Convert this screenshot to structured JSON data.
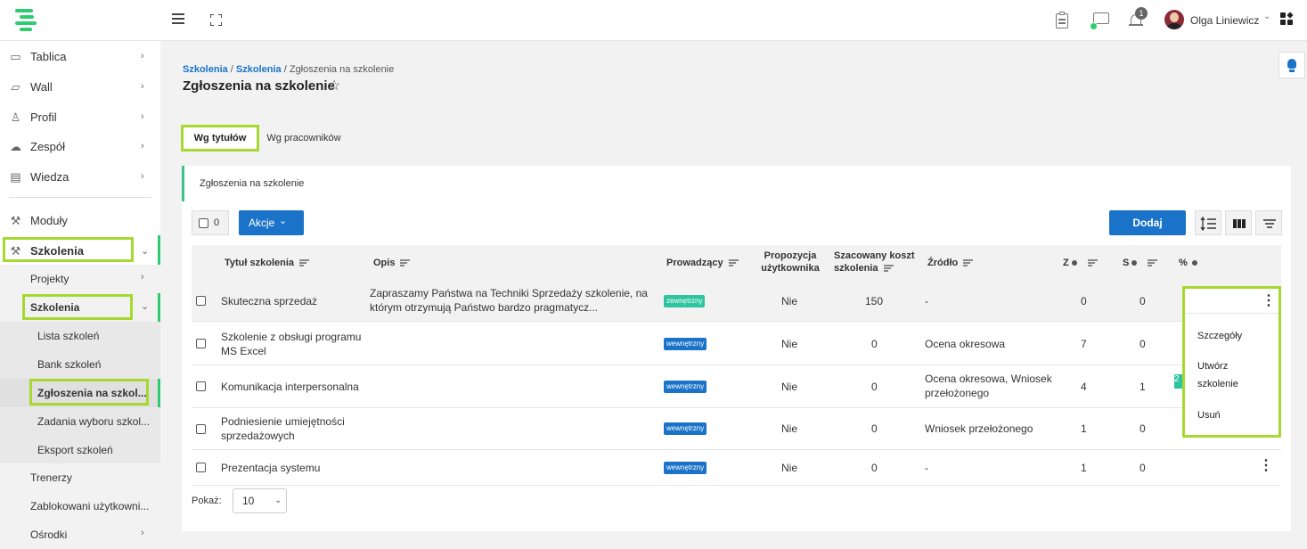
{
  "header": {
    "username": "Olga Liniewicz",
    "notifications_count": "1"
  },
  "sidebar": {
    "items": [
      {
        "label": "Tablica"
      },
      {
        "label": "Wall"
      },
      {
        "label": "Profil"
      },
      {
        "label": "Zespół"
      },
      {
        "label": "Wiedza"
      },
      {
        "label": "Moduły"
      },
      {
        "label": "Szkolenia"
      }
    ],
    "sub": [
      {
        "label": "Projekty"
      },
      {
        "label": "Szkolenia"
      }
    ],
    "sub2": [
      {
        "label": "Lista szkoleń"
      },
      {
        "label": "Bank szkoleń"
      },
      {
        "label": "Zgłoszenia na szkol..."
      },
      {
        "label": "Zadania wyboru szkol..."
      },
      {
        "label": "Eksport szkoleń"
      }
    ],
    "bottom": [
      {
        "label": "Trenerzy"
      },
      {
        "label": "Zablokowani użytkowni..."
      },
      {
        "label": "Ośrodki"
      }
    ]
  },
  "breadcrumb": {
    "part1": "Szkolenia",
    "sep": " / ",
    "part2": "Szkolenia",
    "part3": "Zgłoszenia na szkolenie"
  },
  "page_title": "Zgłoszenia na szkolenie",
  "tabs": [
    {
      "label": "Wg tytułów"
    },
    {
      "label": "Wg pracowników"
    }
  ],
  "card_title": "Zgłoszenia na szkolenie",
  "toolbar": {
    "selected_count": "0",
    "actions_label": "Akcje",
    "add_label": "Dodaj"
  },
  "table": {
    "headers": {
      "title": "Tytuł szkolenia",
      "desc": "Opis",
      "lead": "Prowadzący",
      "prop1": "Propozycja",
      "prop2": "użytkownika",
      "cost1": "Szacowany koszt",
      "cost2": "szkolenia",
      "source": "Źródło",
      "z": "Z",
      "s": "S",
      "pct": "%"
    },
    "rows": [
      {
        "title": "Skuteczna sprzedaż",
        "desc1": "Zapraszamy Państwa na Techniki Sprzedaży szkolenie, na",
        "desc2": "którym otrzymują Państwo bardzo pragmatycz...",
        "tag": "zewnętrzny",
        "prop": "Nie",
        "cost": "150",
        "source": "-",
        "z": "0",
        "s": "0"
      },
      {
        "title": "Szkolenie z obsługi programu",
        "title2": "MS Excel",
        "tag": "wewnętrzny",
        "prop": "Nie",
        "cost": "0",
        "source": "Ocena okresowa",
        "z": "7",
        "s": "0"
      },
      {
        "title": "Komunikacja interpersonalna",
        "tag": "wewnętrzny",
        "prop": "Nie",
        "cost": "0",
        "source": "Ocena okresowa, Wniosek",
        "source2": "przełożonego",
        "z": "4",
        "s": "1",
        "pct": "2"
      },
      {
        "title": "Podniesienie umiejętności",
        "title2": "sprzedażowych",
        "tag": "wewnętrzny",
        "prop": "Nie",
        "cost": "0",
        "source": "Wniosek przełożonego",
        "z": "1",
        "s": "0"
      },
      {
        "title": "Prezentacja systemu",
        "tag": "wewnętrzny",
        "prop": "Nie",
        "cost": "0",
        "source": "-",
        "z": "1",
        "s": "0"
      }
    ]
  },
  "context_menu": {
    "details": "Szczegóły",
    "create1": "Utwórz",
    "create2": "szkolenie",
    "delete": "Usuń"
  },
  "pagination": {
    "show_label": "Pokaż:",
    "page_size": "10"
  },
  "colors": {
    "accent": "#1a73c8",
    "highlight": "#a6d930",
    "green": "#2ecc71"
  }
}
